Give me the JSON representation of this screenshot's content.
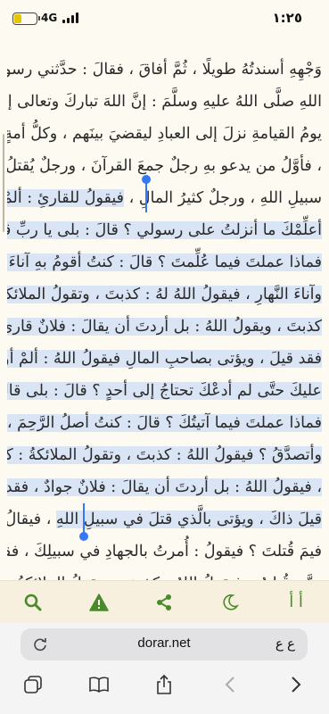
{
  "status_bar": {
    "time": "١:٢٥",
    "network": "4G",
    "battery_level": 0.35,
    "battery_color": "#e6c400"
  },
  "reader": {
    "highlight_color": "#d9e4f5",
    "lines": [
      {
        "segments": [
          {
            "text": "وَجْهِهِ أسندتُهُ طويلًا ، ثُمَّ أفاقَ ، فقالَ : حدَّثني رسولُ",
            "hl": false
          }
        ]
      },
      {
        "segments": [
          {
            "text": "اللهِ صلَّى اللهُ عليهِ وسلَّمَ : إنَّ اللهَ تباركَ وتعالى إذا كانَ",
            "hl": false
          }
        ]
      },
      {
        "segments": [
          {
            "text": "يومُ القيامةِ نزلَ إلى العبادِ ليقضيَ بينَهم ، وكلُّ أمةٍ جاثيةٌ",
            "hl": false
          }
        ]
      },
      {
        "segments": [
          {
            "text": "، فأوَّلُ من يدعو بهِ رجلٌ جمعَ القرآنَ ، ورجلٌ يُقتلُ في",
            "hl": false
          }
        ]
      },
      {
        "segments": [
          {
            "text": "سبيلِ اللهِ ، ورجلٌ كثيرُ المالِ ، ",
            "hl": false
          },
          {
            "text": "فيقولُ للقارئِ : ألمْ",
            "hl": true
          }
        ]
      },
      {
        "segments": [
          {
            "text": "أعلِّمْكَ ما أنزلتُ على رسولي ؟ قالَ : بلى يا ربِّ قالَ :",
            "hl": true
          }
        ]
      },
      {
        "segments": [
          {
            "text": "فماذا عملتَ فيما عُلِّمتَ ؟ قالَ : كنتُ أقومُ بهِ آناءَ الليلِ",
            "hl": true
          }
        ]
      },
      {
        "segments": [
          {
            "text": "وآناءَ النَّهارِ ، فيقولُ اللهُ لهُ : كذبتَ ، وتقولُ الملائكةُ :",
            "hl": true
          }
        ]
      },
      {
        "segments": [
          {
            "text": "كذبتَ ، ويقولُ اللهُ : بل أردتَ أن يقالَ : فلانٌ قارئٌ ،",
            "hl": true
          }
        ]
      },
      {
        "segments": [
          {
            "text": "فقد قيلَ ، ويؤتى بصاحبِ المالِ فيقولُ اللهُ : ألمْ أوسِّعْ",
            "hl": true
          }
        ]
      },
      {
        "segments": [
          {
            "text": "عليكَ حتَّى لم أدعْكَ تحتاجُ إلى أحدٍ ؟ قالَ : بلى قالَ :",
            "hl": true
          }
        ]
      },
      {
        "segments": [
          {
            "text": "فماذا عملتَ فيما آتيتُكَ ؟ قالَ : كنتُ أصلُ الرَّحِمَ ،",
            "hl": true
          }
        ]
      },
      {
        "segments": [
          {
            "text": "وأتصدَّقُ ؟ فيقولُ اللهُ : كذبتَ ، وتقولُ الملائكةُ : كذبتَ",
            "hl": true
          }
        ]
      },
      {
        "segments": [
          {
            "text": "، فيقولُ اللهُ : بل أردتَ أن يقالَ : فلانٌ جوادٌ ، فقد",
            "hl": true
          }
        ]
      },
      {
        "segments": [
          {
            "text": "قيلَ ذاكَ ، ويؤتى بالَّذي قتلَ في سبيلِ اللهِ",
            "hl": true
          },
          {
            "text": " ، فيقالُ لهُ :",
            "hl": false
          }
        ]
      },
      {
        "segments": [
          {
            "text": "فيمَ قُتلتَ ؟ فيقولُ : أُمرتُ بالجهادِ في سبيلِكَ ، فقاتلتُ",
            "hl": false
          }
        ]
      },
      {
        "segments": [
          {
            "text": "حتَّى قُتلتُ ، فيقولُ اللهُ : كذبتَ ، وتقولُ الملائكةُ :",
            "hl": false
          }
        ]
      }
    ]
  },
  "toolbar": {
    "accent_color": "#4a8a2a",
    "font_label": "أ أ",
    "icons": [
      "search-icon",
      "warning-icon",
      "share-icon",
      "moon-icon",
      "font-size-icon"
    ]
  },
  "browser": {
    "url": "dorar.net",
    "text_size_label": "ع ع"
  }
}
